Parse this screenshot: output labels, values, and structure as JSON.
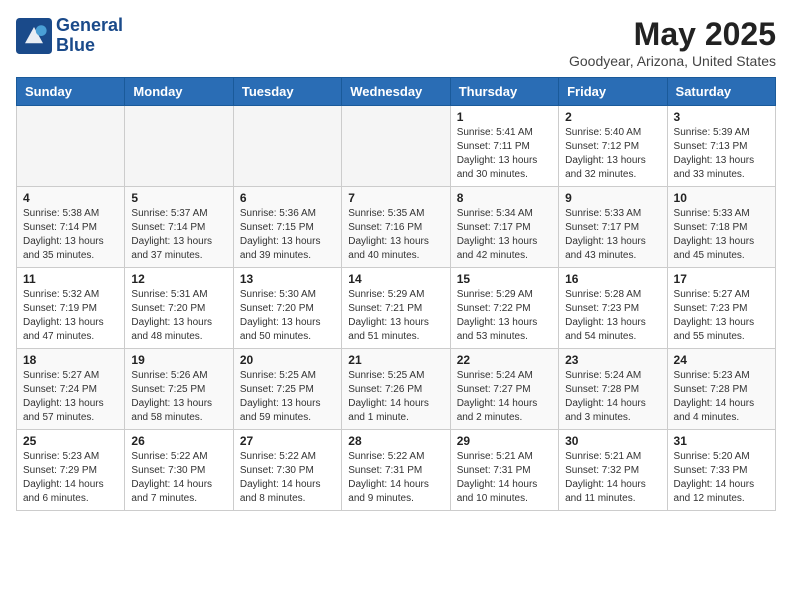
{
  "logo": {
    "name": "GeneralBlue",
    "line1": "General",
    "line2": "Blue"
  },
  "title": "May 2025",
  "location": "Goodyear, Arizona, United States",
  "days_of_week": [
    "Sunday",
    "Monday",
    "Tuesday",
    "Wednesday",
    "Thursday",
    "Friday",
    "Saturday"
  ],
  "weeks": [
    [
      {
        "day": "",
        "info": ""
      },
      {
        "day": "",
        "info": ""
      },
      {
        "day": "",
        "info": ""
      },
      {
        "day": "",
        "info": ""
      },
      {
        "day": "1",
        "info": "Sunrise: 5:41 AM\nSunset: 7:11 PM\nDaylight: 13 hours\nand 30 minutes."
      },
      {
        "day": "2",
        "info": "Sunrise: 5:40 AM\nSunset: 7:12 PM\nDaylight: 13 hours\nand 32 minutes."
      },
      {
        "day": "3",
        "info": "Sunrise: 5:39 AM\nSunset: 7:13 PM\nDaylight: 13 hours\nand 33 minutes."
      }
    ],
    [
      {
        "day": "4",
        "info": "Sunrise: 5:38 AM\nSunset: 7:14 PM\nDaylight: 13 hours\nand 35 minutes."
      },
      {
        "day": "5",
        "info": "Sunrise: 5:37 AM\nSunset: 7:14 PM\nDaylight: 13 hours\nand 37 minutes."
      },
      {
        "day": "6",
        "info": "Sunrise: 5:36 AM\nSunset: 7:15 PM\nDaylight: 13 hours\nand 39 minutes."
      },
      {
        "day": "7",
        "info": "Sunrise: 5:35 AM\nSunset: 7:16 PM\nDaylight: 13 hours\nand 40 minutes."
      },
      {
        "day": "8",
        "info": "Sunrise: 5:34 AM\nSunset: 7:17 PM\nDaylight: 13 hours\nand 42 minutes."
      },
      {
        "day": "9",
        "info": "Sunrise: 5:33 AM\nSunset: 7:17 PM\nDaylight: 13 hours\nand 43 minutes."
      },
      {
        "day": "10",
        "info": "Sunrise: 5:33 AM\nSunset: 7:18 PM\nDaylight: 13 hours\nand 45 minutes."
      }
    ],
    [
      {
        "day": "11",
        "info": "Sunrise: 5:32 AM\nSunset: 7:19 PM\nDaylight: 13 hours\nand 47 minutes."
      },
      {
        "day": "12",
        "info": "Sunrise: 5:31 AM\nSunset: 7:20 PM\nDaylight: 13 hours\nand 48 minutes."
      },
      {
        "day": "13",
        "info": "Sunrise: 5:30 AM\nSunset: 7:20 PM\nDaylight: 13 hours\nand 50 minutes."
      },
      {
        "day": "14",
        "info": "Sunrise: 5:29 AM\nSunset: 7:21 PM\nDaylight: 13 hours\nand 51 minutes."
      },
      {
        "day": "15",
        "info": "Sunrise: 5:29 AM\nSunset: 7:22 PM\nDaylight: 13 hours\nand 53 minutes."
      },
      {
        "day": "16",
        "info": "Sunrise: 5:28 AM\nSunset: 7:23 PM\nDaylight: 13 hours\nand 54 minutes."
      },
      {
        "day": "17",
        "info": "Sunrise: 5:27 AM\nSunset: 7:23 PM\nDaylight: 13 hours\nand 55 minutes."
      }
    ],
    [
      {
        "day": "18",
        "info": "Sunrise: 5:27 AM\nSunset: 7:24 PM\nDaylight: 13 hours\nand 57 minutes."
      },
      {
        "day": "19",
        "info": "Sunrise: 5:26 AM\nSunset: 7:25 PM\nDaylight: 13 hours\nand 58 minutes."
      },
      {
        "day": "20",
        "info": "Sunrise: 5:25 AM\nSunset: 7:25 PM\nDaylight: 13 hours\nand 59 minutes."
      },
      {
        "day": "21",
        "info": "Sunrise: 5:25 AM\nSunset: 7:26 PM\nDaylight: 14 hours\nand 1 minute."
      },
      {
        "day": "22",
        "info": "Sunrise: 5:24 AM\nSunset: 7:27 PM\nDaylight: 14 hours\nand 2 minutes."
      },
      {
        "day": "23",
        "info": "Sunrise: 5:24 AM\nSunset: 7:28 PM\nDaylight: 14 hours\nand 3 minutes."
      },
      {
        "day": "24",
        "info": "Sunrise: 5:23 AM\nSunset: 7:28 PM\nDaylight: 14 hours\nand 4 minutes."
      }
    ],
    [
      {
        "day": "25",
        "info": "Sunrise: 5:23 AM\nSunset: 7:29 PM\nDaylight: 14 hours\nand 6 minutes."
      },
      {
        "day": "26",
        "info": "Sunrise: 5:22 AM\nSunset: 7:30 PM\nDaylight: 14 hours\nand 7 minutes."
      },
      {
        "day": "27",
        "info": "Sunrise: 5:22 AM\nSunset: 7:30 PM\nDaylight: 14 hours\nand 8 minutes."
      },
      {
        "day": "28",
        "info": "Sunrise: 5:22 AM\nSunset: 7:31 PM\nDaylight: 14 hours\nand 9 minutes."
      },
      {
        "day": "29",
        "info": "Sunrise: 5:21 AM\nSunset: 7:31 PM\nDaylight: 14 hours\nand 10 minutes."
      },
      {
        "day": "30",
        "info": "Sunrise: 5:21 AM\nSunset: 7:32 PM\nDaylight: 14 hours\nand 11 minutes."
      },
      {
        "day": "31",
        "info": "Sunrise: 5:20 AM\nSunset: 7:33 PM\nDaylight: 14 hours\nand 12 minutes."
      }
    ]
  ]
}
